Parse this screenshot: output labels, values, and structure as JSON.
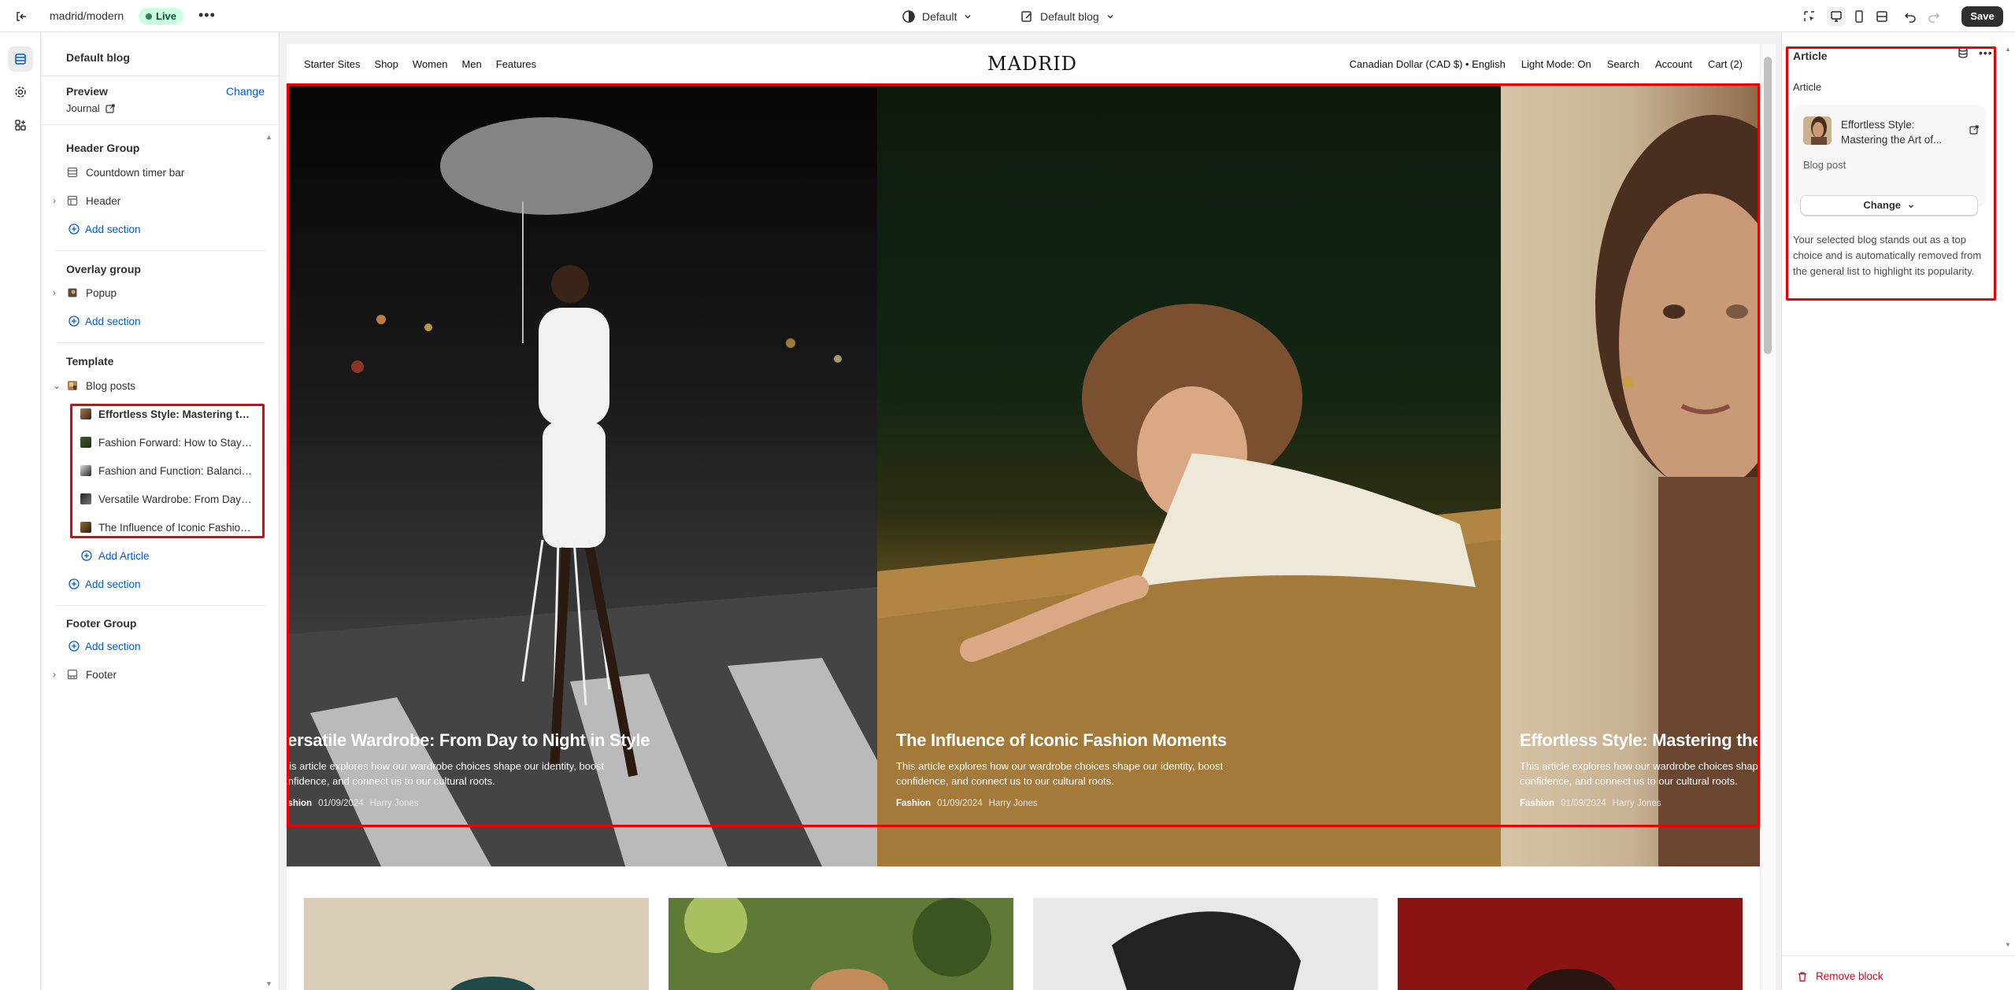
{
  "topbar": {
    "store_name": "madrid/modern",
    "status_badge": "Live",
    "more": "•••",
    "theme_label": "Default",
    "template_label": "Default blog",
    "save_label": "Save"
  },
  "sidebar": {
    "title": "Default blog",
    "preview_label": "Preview",
    "change_label": "Change",
    "preview_target": "Journal",
    "header_group": {
      "title": "Header Group",
      "items": [
        "Countdown timer bar",
        "Header"
      ],
      "add_label": "Add section"
    },
    "overlay_group": {
      "title": "Overlay group",
      "items": [
        "Popup"
      ],
      "add_label": "Add section"
    },
    "template": {
      "title": "Template",
      "section": "Blog posts",
      "articles": [
        "Effortless Style: Mastering the Art of Minimalist Fashion",
        "Fashion Forward: How to Stay Ahead of Trends",
        "Fashion and Function: Balancing Style and Comfort",
        "Versatile Wardrobe: From Day to Night in Style",
        "The Influence of Iconic Fashion Moments"
      ],
      "add_article_label": "Add Article",
      "add_label": "Add section"
    },
    "footer_group": {
      "title": "Footer Group",
      "add_label": "Add section",
      "items": [
        "Footer"
      ]
    }
  },
  "site": {
    "nav_left": [
      "Starter Sites",
      "Shop",
      "Women",
      "Men",
      "Features"
    ],
    "logo": "MADRID",
    "nav_right": [
      "Canadian Dollar (CAD $)  •  English",
      "Light Mode: On",
      "Search",
      "Account",
      "Cart (2)"
    ],
    "slides": [
      {
        "title": "Versatile Wardrobe: From Day to Night in Style",
        "excerpt": "This article explores how our wardrobe choices shape our identity, boost confidence, and connect us to our cultural roots.",
        "tag": "Fashion",
        "date": "01/09/2024",
        "author": "Harry Jones"
      },
      {
        "title": "The Influence of Iconic Fashion Moments",
        "excerpt": "This article explores how our wardrobe choices shape our identity, boost confidence, and connect us to our cultural roots.",
        "tag": "Fashion",
        "date": "01/09/2024",
        "author": "Harry Jones"
      },
      {
        "title": "Effortless Style: Mastering the Art of Minimalist Fashion",
        "excerpt": "This article explores how our wardrobe choices shape our identity, boost confidence, and connect us to our cultural roots.",
        "tag": "Fashion",
        "date": "01/09/2024",
        "author": "Harry Jones"
      }
    ]
  },
  "right_panel": {
    "title": "Article",
    "subtitle": "Article",
    "article_title": "Effortless Style: Mastering the Art of...",
    "article_type": "Blog post",
    "change_label": "Change",
    "description": "Your selected blog stands out as a top choice and is automatically removed from the general list to highlight its popularity.",
    "remove_label": "Remove block"
  },
  "colors": {
    "accent": "#005bd3",
    "highlight": "#ee0000",
    "live": "#29845a",
    "danger": "#c70a24"
  }
}
